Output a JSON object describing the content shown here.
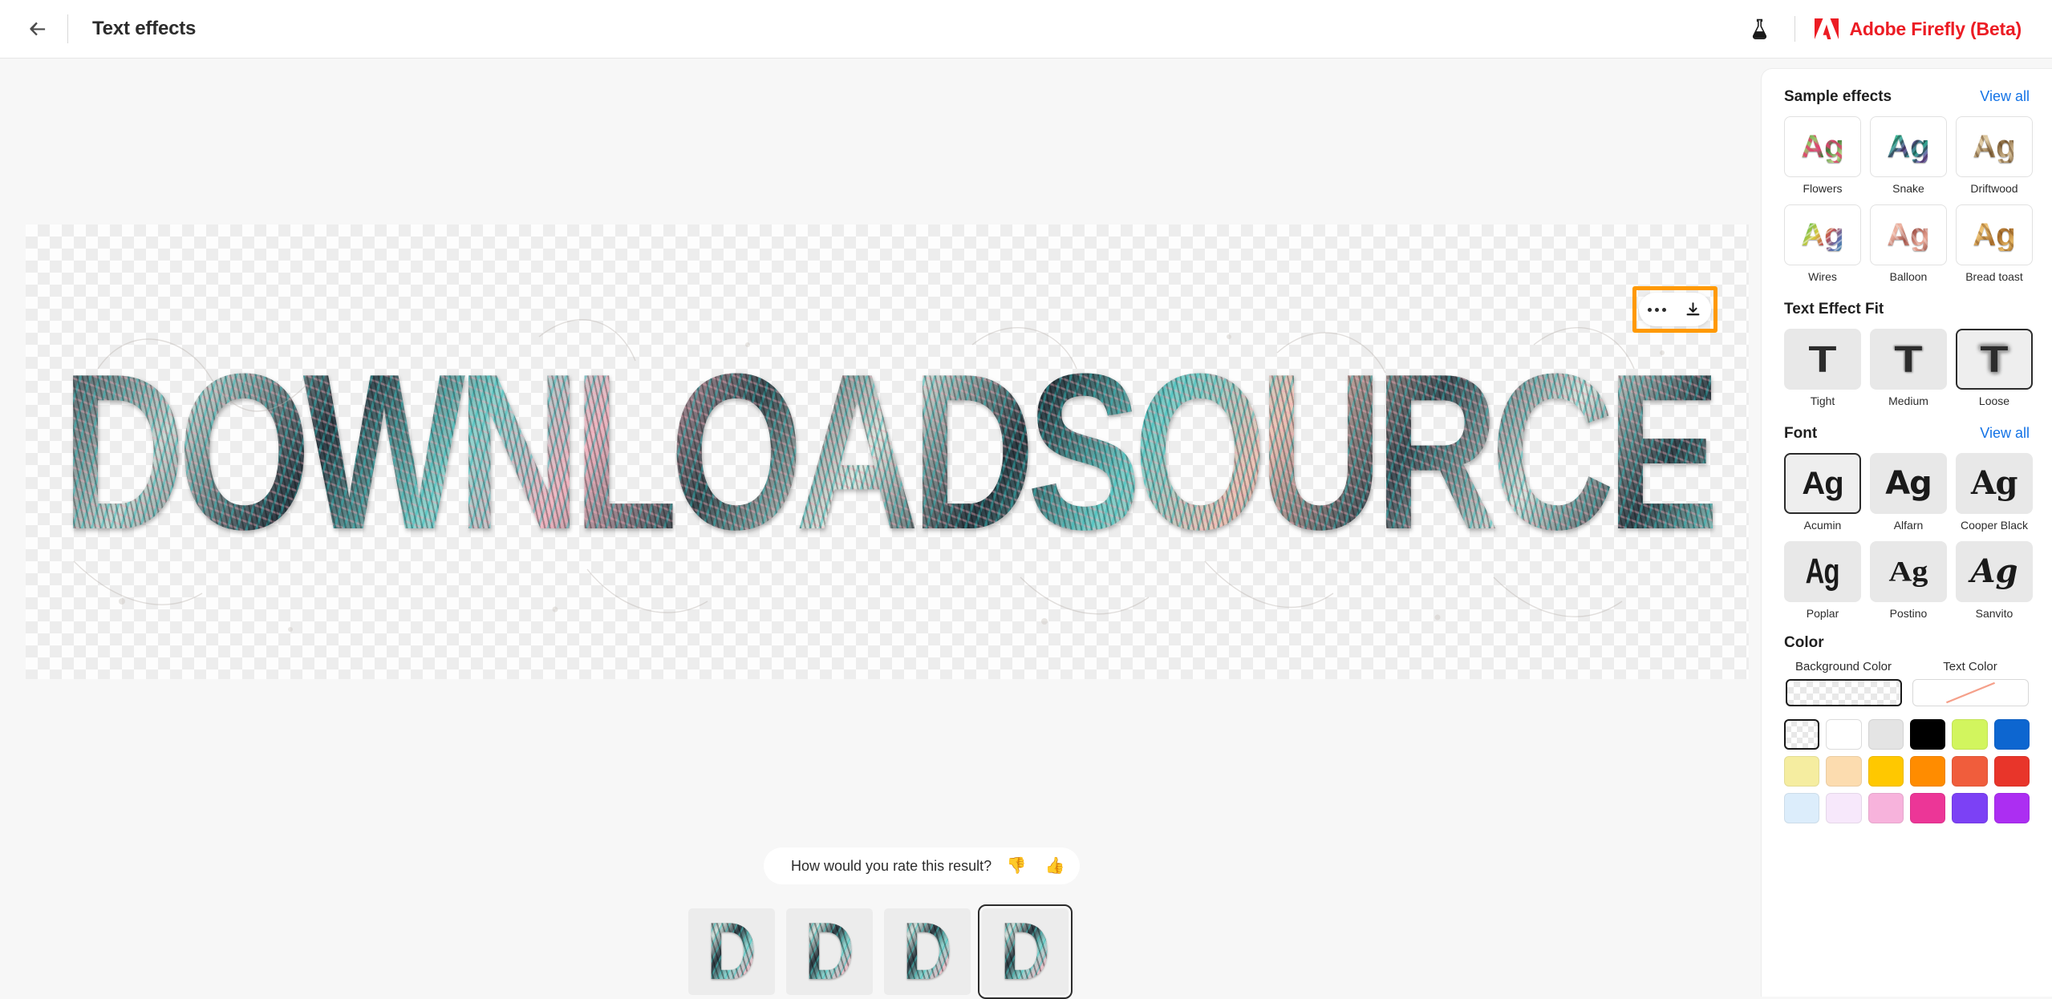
{
  "header": {
    "back_icon": "arrow-left-icon",
    "title": "Text effects",
    "flask_icon": "beaker-icon",
    "brand": "Adobe Firefly (Beta)",
    "brand_color": "#ec1c24"
  },
  "canvas": {
    "artwork_text": "DOWNLOADSOURCE",
    "background": "transparent-checkerboard",
    "toolbar": {
      "more_icon": "more-options-icon",
      "download_icon": "download-icon",
      "highlight_color": "#ff9900"
    }
  },
  "rating": {
    "question": "How would you rate this result?",
    "thumbs_down": "👎",
    "thumbs_up": "👍"
  },
  "thumbnails": {
    "items": [
      {
        "letter": "D",
        "selected": false
      },
      {
        "letter": "D",
        "selected": false
      },
      {
        "letter": "D",
        "selected": false
      },
      {
        "letter": "D",
        "selected": true
      }
    ]
  },
  "sidebar": {
    "sample_effects": {
      "title": "Sample effects",
      "view_all": "View all",
      "items": [
        {
          "label": "Flowers",
          "preview": "Ag",
          "style": "ag-flowers"
        },
        {
          "label": "Snake",
          "preview": "Ag",
          "style": "ag-snake"
        },
        {
          "label": "Driftwood",
          "preview": "Ag",
          "style": "ag-driftwood"
        },
        {
          "label": "Wires",
          "preview": "Ag",
          "style": "ag-wires"
        },
        {
          "label": "Balloon",
          "preview": "Ag",
          "style": "ag-balloon"
        },
        {
          "label": "Bread toast",
          "preview": "Ag",
          "style": "ag-bread"
        }
      ]
    },
    "text_effect_fit": {
      "title": "Text Effect Fit",
      "items": [
        {
          "label": "Tight",
          "glyph": "T",
          "selected": false
        },
        {
          "label": "Medium",
          "glyph": "T",
          "selected": false
        },
        {
          "label": "Loose",
          "glyph": "T",
          "selected": true
        }
      ],
      "selected": "Loose"
    },
    "font": {
      "title": "Font",
      "view_all": "View all",
      "items": [
        {
          "label": "Acumin",
          "preview": "Ag",
          "selected": true
        },
        {
          "label": "Alfarn",
          "preview": "Ag",
          "selected": false
        },
        {
          "label": "Cooper Black",
          "preview": "Ag",
          "selected": false
        },
        {
          "label": "Poplar",
          "preview": "Ag",
          "selected": false
        },
        {
          "label": "Postino",
          "preview": "Ag",
          "selected": false
        },
        {
          "label": "Sanvito",
          "preview": "Ag",
          "selected": false
        }
      ],
      "selected": "Acumin"
    },
    "color": {
      "title": "Color",
      "background_color_label": "Background Color",
      "text_color_label": "Text Color",
      "background_color_value": "transparent",
      "text_color_value": "none",
      "swatches": [
        "transparent",
        "#ffffff",
        "#e4e4e4",
        "#000000",
        "#d2f55e",
        "#0d66d0",
        "#f5eda0",
        "#fcdcaf",
        "#ffc800",
        "#ff8c00",
        "#f05d3c",
        "#e8352a",
        "#dcedfb",
        "#f7e8fb",
        "#f7b3dc",
        "#ec3697",
        "#7c41f5",
        "#ac2ef2"
      ],
      "selected_swatch": "transparent"
    }
  }
}
